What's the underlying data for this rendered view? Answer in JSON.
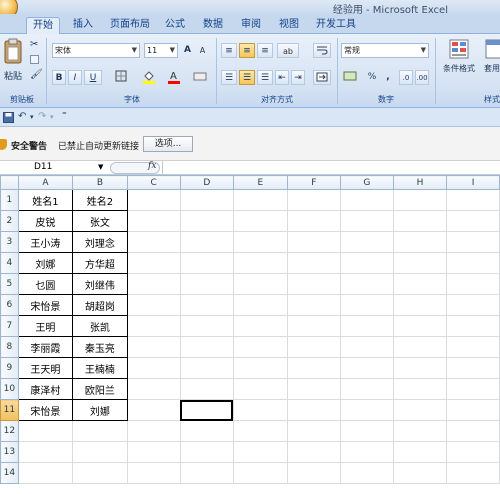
{
  "window": {
    "title": "经验用 - Microsoft Excel"
  },
  "tabs": [
    {
      "label": "开始",
      "active": true
    },
    {
      "label": "插入",
      "active": false
    },
    {
      "label": "页面布局",
      "active": false
    },
    {
      "label": "公式",
      "active": false
    },
    {
      "label": "数据",
      "active": false
    },
    {
      "label": "审阅",
      "active": false
    },
    {
      "label": "视图",
      "active": false
    },
    {
      "label": "开发工具",
      "active": false
    }
  ],
  "ribbon": {
    "paste_label": "粘贴",
    "font_name": "宋体",
    "font_size": "11",
    "grow_font": "A",
    "shrink_font": "A",
    "bold": "B",
    "italic": "I",
    "underline": "U",
    "number_format": "常规",
    "percent": "%",
    "comma": ",",
    "conditional_format": "条件格式",
    "format_table": "套用表格格式",
    "groups": {
      "clipboard": "剪贴板",
      "font": "字体",
      "alignment": "对齐方式",
      "number": "数字",
      "styles": "样式"
    }
  },
  "security": {
    "title": "安全警告",
    "message": "已禁止自动更新链接",
    "button": "选项..."
  },
  "formula_bar": {
    "name_box": "D11",
    "fx": "fx",
    "value": ""
  },
  "sheet": {
    "columns": [
      "A",
      "B",
      "C",
      "D",
      "E",
      "F",
      "G",
      "H",
      "I"
    ],
    "rows": [
      "1",
      "2",
      "3",
      "4",
      "5",
      "6",
      "7",
      "8",
      "9",
      "10",
      "11",
      "12",
      "13",
      "14"
    ],
    "active_cell": "D11",
    "data": [
      [
        "姓名1",
        "姓名2"
      ],
      [
        "皮锐",
        "张文"
      ],
      [
        "王小涛",
        "刘理念"
      ],
      [
        "刘娜",
        "方华超"
      ],
      [
        "乜圆",
        "刘继伟"
      ],
      [
        "宋怡景",
        "胡超岗"
      ],
      [
        "王明",
        "张凯"
      ],
      [
        "李丽霞",
        "秦玉亮"
      ],
      [
        "王天明",
        "王楠楠"
      ],
      [
        "康泽村",
        "欧阳兰"
      ],
      [
        "宋怡景",
        "刘娜"
      ]
    ]
  },
  "colors": {
    "ribbon_bg": "#d6e3f3",
    "tab_text": "#15428b",
    "selected_header": "#f1c15f",
    "grid_line": "#dadcdd"
  }
}
